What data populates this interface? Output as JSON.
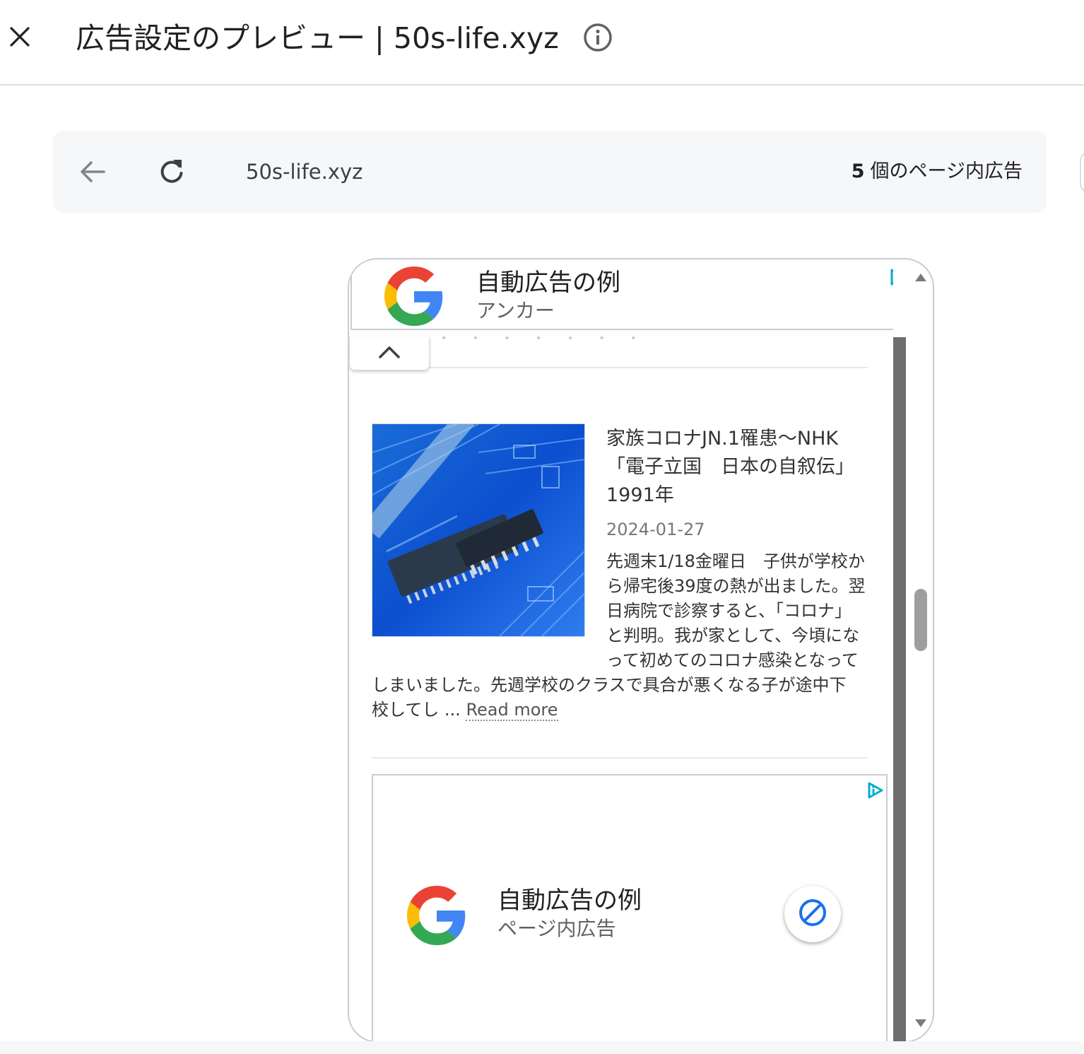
{
  "header": {
    "title": "広告設定のプレビュー | 50s-life.xyz",
    "close_icon": "close-icon",
    "info_icon": "info-icon"
  },
  "browser": {
    "url": "50s-life.xyz",
    "ad_count_number": "5",
    "ad_count_label": "個のページ内広告",
    "back_icon": "arrow-back-icon",
    "reload_icon": "refresh-icon"
  },
  "anchor_ad": {
    "title": "自動広告の例",
    "subtitle": "アンカー",
    "collapse_icon": "chevron-up-icon"
  },
  "article": {
    "title": "家族コロナJN.1罹患〜NHK「電子立国　日本の自叙伝」1991年",
    "date": "2024-01-27",
    "excerpt_lines": [
      "先週末1/18金曜日　子供が学校か",
      "ら帰宅後39度の熱が出ました。翌",
      "日病院で診察すると、「コロナ」",
      "と判明。我が家として、今頃にな",
      "って初めてのコロナ感染となって",
      "しまいました。先週学校のクラスで具合が悪くなる子が途中下",
      "校してし ..."
    ],
    "read_more": "Read more"
  },
  "inpage_ad": {
    "title": "自動広告の例",
    "subtitle": "ページ内広告",
    "block_icon": "block-icon"
  },
  "colors": {
    "google_blue": "#4285F4",
    "google_red": "#EA4335",
    "google_yellow": "#FBBC05",
    "google_green": "#34A853",
    "adchoices": "#00AECD",
    "block_blue": "#1a73e8"
  }
}
